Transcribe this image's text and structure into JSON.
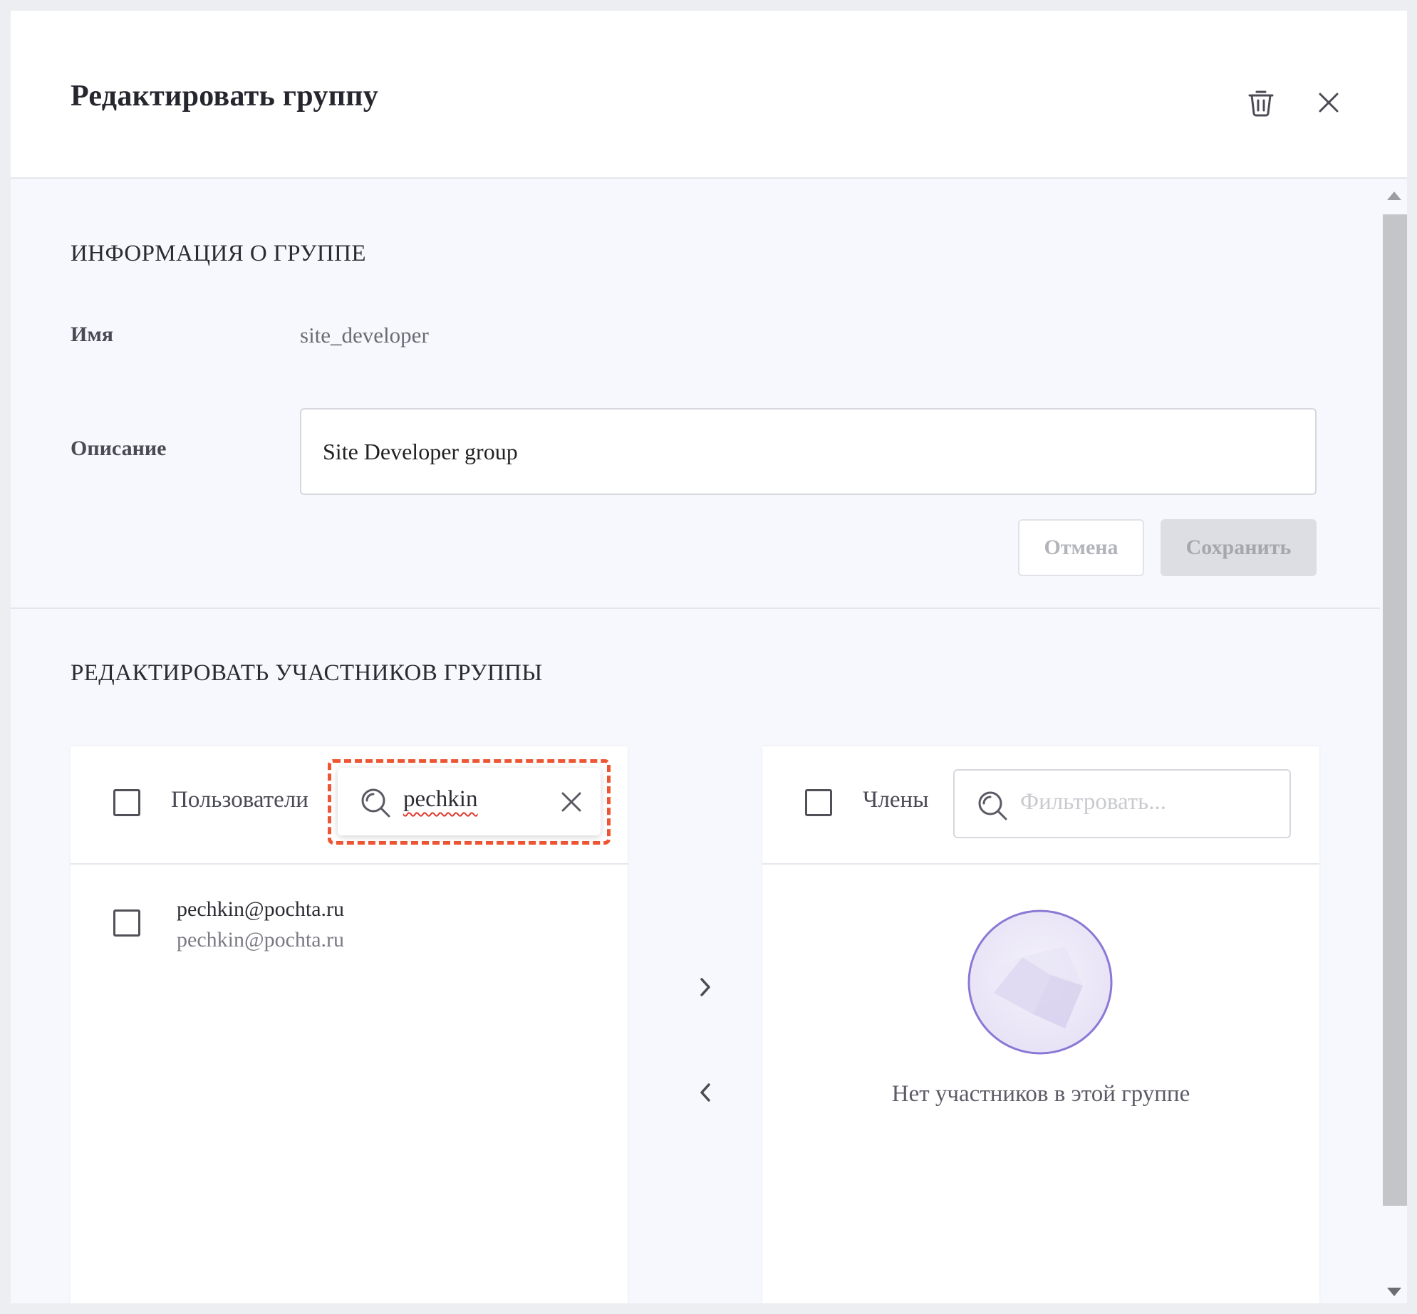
{
  "dialog": {
    "title": "Редактировать группу",
    "icons": {
      "delete": "trash-icon",
      "close": "close-icon"
    }
  },
  "info": {
    "section_title": "ИНФОРМАЦИЯ О ГРУППЕ",
    "name_label": "Имя",
    "name_value": "site_developer",
    "description_label": "Описание",
    "description_value": "Site Developer group",
    "cancel_label": "Отмена",
    "save_label": "Сохранить"
  },
  "members": {
    "section_title": "РЕДАКТИРОВАТЬ УЧАСТНИКОВ ГРУППЫ",
    "users_panel": {
      "label": "Пользователи",
      "search_value": "pechkin",
      "items": [
        {
          "title": "pechkin@pochta.ru",
          "subtitle": "pechkin@pochta.ru"
        }
      ]
    },
    "members_panel": {
      "label": "Члены",
      "filter_placeholder": "Фильтровать...",
      "empty_text": "Нет участников в этой группе"
    }
  },
  "colors": {
    "focus_outline": "#ee5533",
    "spellcheck_underline": "#e0392b",
    "illustration": "#7b66cf"
  }
}
